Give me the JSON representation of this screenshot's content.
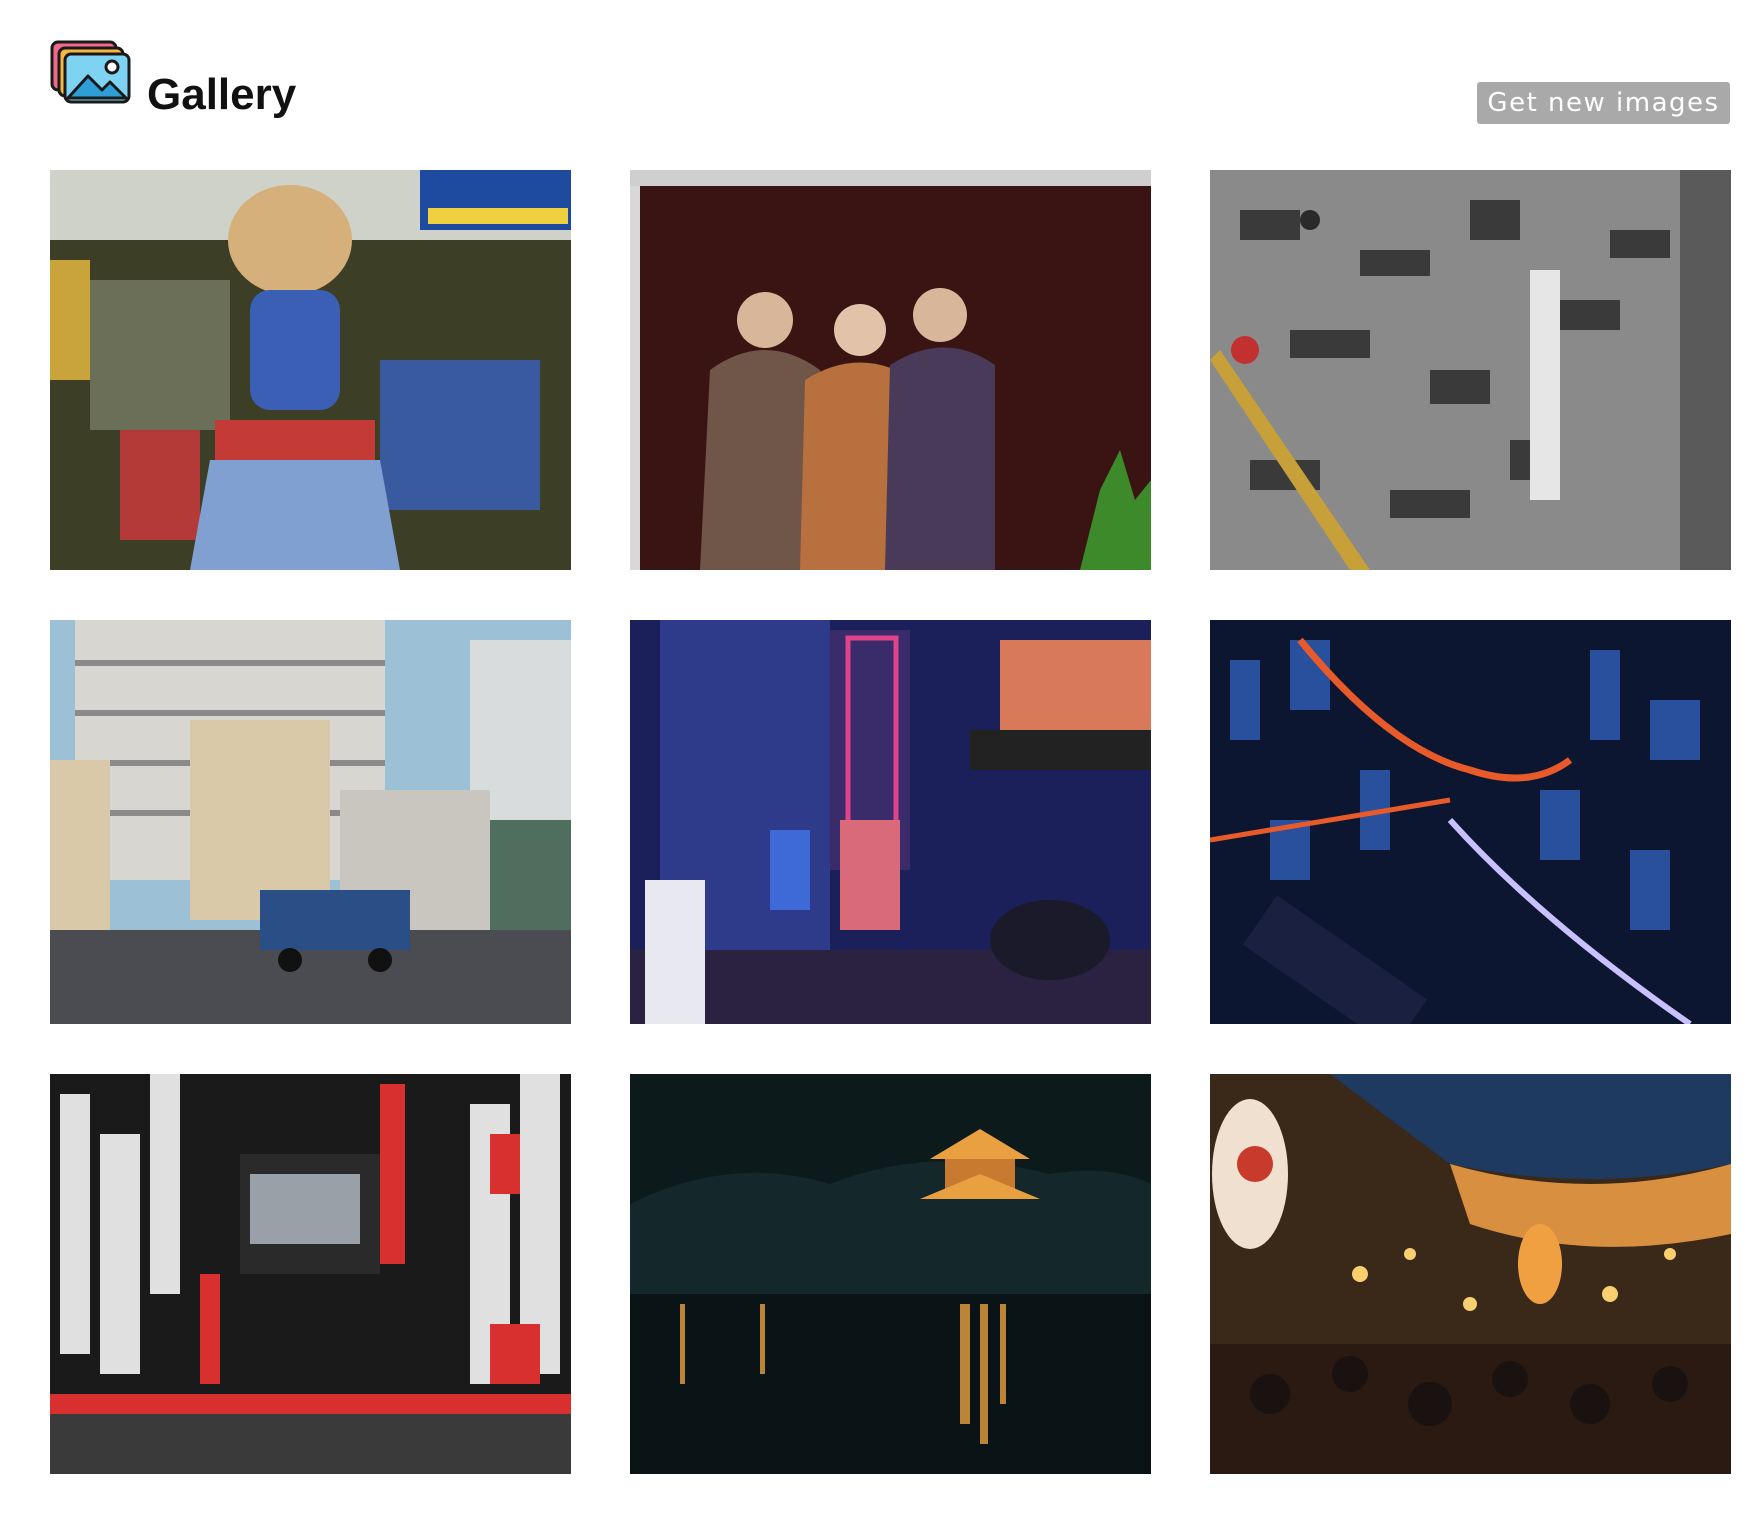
{
  "header": {
    "title": "Gallery",
    "logo_icon": "gallery-icon",
    "button_label": "Get new images"
  },
  "gallery": {
    "images": [
      {
        "subject": "shop-mascot-statue",
        "palette": [
          "#3c3e26",
          "#5b7fb8",
          "#d44a3a"
        ]
      },
      {
        "subject": "three-women-kimono",
        "palette": [
          "#3a1412",
          "#6f5648",
          "#b8703e"
        ]
      },
      {
        "subject": "pedestrians-tiled-plaza",
        "palette": [
          "#8a8a8a",
          "#3a3a3a",
          "#c23030"
        ]
      },
      {
        "subject": "apartment-street-truck",
        "palette": [
          "#9cc0d6",
          "#d9c9a8",
          "#2a4f86"
        ]
      },
      {
        "subject": "neon-karaoke-alley",
        "palette": [
          "#1b1f5a",
          "#e0448a",
          "#3e6ad8"
        ]
      },
      {
        "subject": "night-city-aerial",
        "palette": [
          "#0c1630",
          "#2f5fb8",
          "#e85a2a"
        ]
      },
      {
        "subject": "shinjuku-signs-street",
        "palette": [
          "#1a1a1a",
          "#e0e0e0",
          "#d8302e"
        ]
      },
      {
        "subject": "pagoda-lake-night",
        "palette": [
          "#0c1a1c",
          "#14272a",
          "#e8a040"
        ]
      },
      {
        "subject": "lantern-market-crowd",
        "palette": [
          "#1e3a60",
          "#d89040",
          "#3a2818"
        ]
      }
    ]
  }
}
